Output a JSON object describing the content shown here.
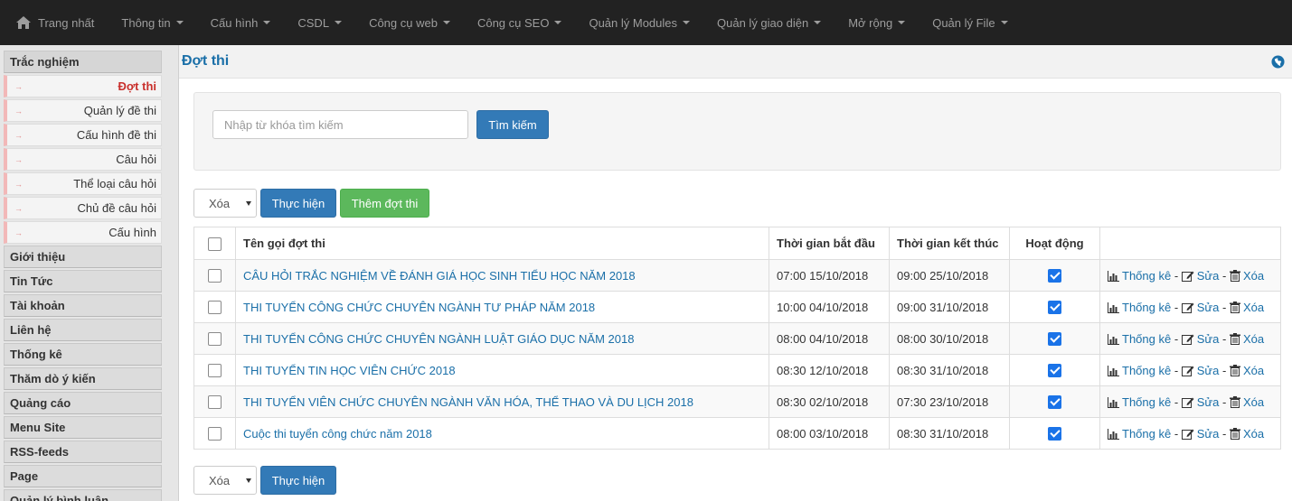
{
  "topnav": {
    "items": [
      {
        "label": "Trang nhất",
        "icon": "home-icon",
        "dropdown": false
      },
      {
        "label": "Thông tin",
        "dropdown": true
      },
      {
        "label": "Cấu hình",
        "dropdown": true
      },
      {
        "label": "CSDL",
        "dropdown": true
      },
      {
        "label": "Công cụ web",
        "dropdown": true
      },
      {
        "label": "Công cụ SEO",
        "dropdown": true
      },
      {
        "label": "Quản lý Modules",
        "dropdown": true
      },
      {
        "label": "Quản lý giao diện",
        "dropdown": true
      },
      {
        "label": "Mở rộng",
        "dropdown": true
      },
      {
        "label": "Quản lý File",
        "dropdown": true
      }
    ]
  },
  "sidebar": {
    "open_group": "Trắc nghiệm",
    "sub_items": [
      "Đợt thi",
      "Quản lý đề thi",
      "Cấu hình đề thi",
      "Câu hỏi",
      "Thể loại câu hỏi",
      "Chủ đề câu hỏi",
      "Cấu hình"
    ],
    "groups": [
      "Giới thiệu",
      "Tin Tức",
      "Tài khoản",
      "Liên hệ",
      "Thống kê",
      "Thăm dò ý kiến",
      "Quảng cáo",
      "Menu Site",
      "RSS-feeds",
      "Page",
      "Quản lý bình luận"
    ]
  },
  "page": {
    "title": "Đợt thi"
  },
  "search": {
    "placeholder": "Nhập từ khóa tìm kiếm",
    "button": "Tìm kiếm"
  },
  "toolbar": {
    "select_value": "Xóa",
    "execute": "Thực hiện",
    "add": "Thêm đợt thi"
  },
  "table": {
    "headers": {
      "name": "Tên gọi đợt thi",
      "start": "Thời gian bắt đầu",
      "end": "Thời gian kết thúc",
      "active": "Hoạt động"
    },
    "actions": {
      "stats": "Thống kê",
      "edit": "Sửa",
      "delete": "Xóa",
      "separator": " - "
    },
    "rows": [
      {
        "name": "CÂU HỎI TRẮC NGHIỆM VỀ ĐÁNH GIÁ HỌC SINH TIỂU HỌC NĂM 2018",
        "start": "07:00 15/10/2018",
        "end": "09:00 25/10/2018"
      },
      {
        "name": "THI TUYỂN CÔNG CHỨC CHUYÊN NGÀNH TƯ PHÁP NĂM 2018",
        "start": "10:00 04/10/2018",
        "end": "09:00 31/10/2018"
      },
      {
        "name": "THI TUYỂN CÔNG CHỨC CHUYÊN NGÀNH LUẬT GIÁO DỤC NĂM 2018",
        "start": "08:00 04/10/2018",
        "end": "08:00 30/10/2018"
      },
      {
        "name": "THI TUYỂN TIN HỌC VIÊN CHỨC 2018",
        "start": "08:30 12/10/2018",
        "end": "08:30 31/10/2018"
      },
      {
        "name": "THI TUYỂN VIÊN CHỨC CHUYÊN NGÀNH VĂN HÓA, THỂ THAO VÀ DU LỊCH 2018",
        "start": "08:30 02/10/2018",
        "end": "07:30 23/10/2018"
      },
      {
        "name": "Cuộc thi tuyển công chức năm 2018",
        "start": "08:00 03/10/2018",
        "end": "08:30 31/10/2018"
      }
    ]
  },
  "colors": {
    "nav_bg": "#222222",
    "link": "#1a6fa8",
    "primary": "#337ab7",
    "success": "#5cb85c",
    "active_sidebar": "#c9302c"
  }
}
